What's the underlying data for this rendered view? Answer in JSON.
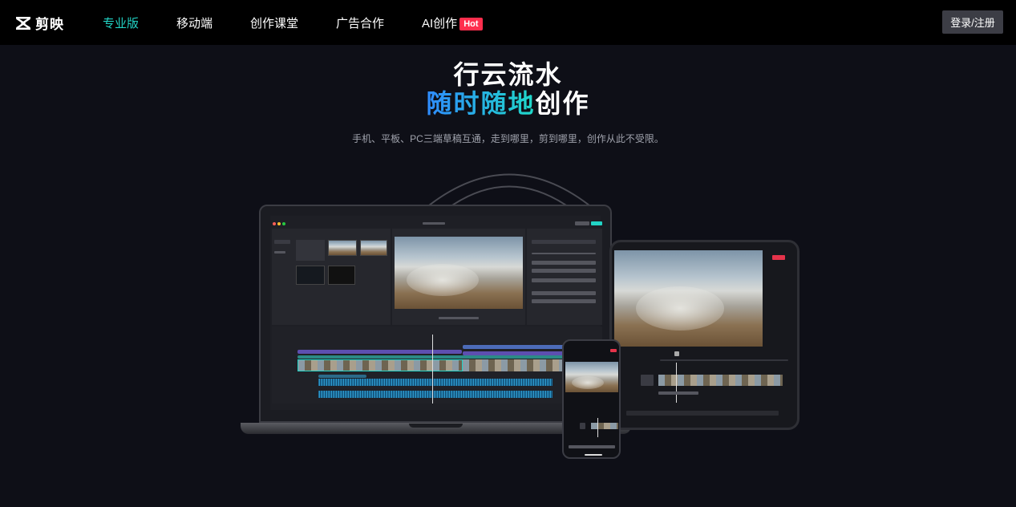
{
  "nav": {
    "logo_text": "剪映",
    "links": [
      "专业版",
      "移动端",
      "创作课堂",
      "广告合作"
    ],
    "ai_link": "AI创作",
    "ai_badge": "Hot",
    "login": "登录/注册",
    "active_color": "#22d3c5",
    "badge_color": "#ff2e4d"
  },
  "hero": {
    "title_line1": "行云流水",
    "title_line2_highlight": "随时随地",
    "title_line2_rest": "创作",
    "subtitle": "手机、平板、PC三端草稿互通，走到哪里，剪到哪里，创作从此不受限。"
  },
  "icons": {
    "logo": "capcut-logo-icon"
  }
}
